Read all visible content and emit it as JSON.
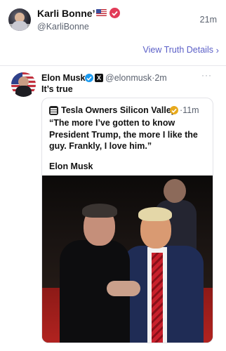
{
  "header": {
    "display_name": "Karli Bonne’",
    "handle": "@KarliBonne",
    "time": "21m",
    "view_details_label": "View Truth Details",
    "view_details_chevron": "›"
  },
  "quoted_post": {
    "author_name": "Elon Musk",
    "author_handle": "@elonmusk",
    "separator": "·",
    "time": "2m",
    "text": "It’s true",
    "more_label": "···",
    "x_badge": "X",
    "embedded": {
      "account_name": "Tesla Owners Silicon Valley",
      "time": "11m",
      "quote_text": "“The more I’ve gotten to know President Trump, the more I like the guy. Frankly, I love him.”",
      "attribution": "Elon Musk"
    }
  },
  "colors": {
    "link": "#5b5fc7",
    "verified_red": "#e23b58",
    "verified_blue": "#1d9bf0",
    "verified_gold": "#e7a91c",
    "muted_text": "#5c6370"
  },
  "icons": [
    "avatar",
    "us-flag-icon",
    "verified-badge-icon",
    "chevron-right-icon",
    "x-logo-icon",
    "more-icon",
    "account-logo-icon"
  ]
}
